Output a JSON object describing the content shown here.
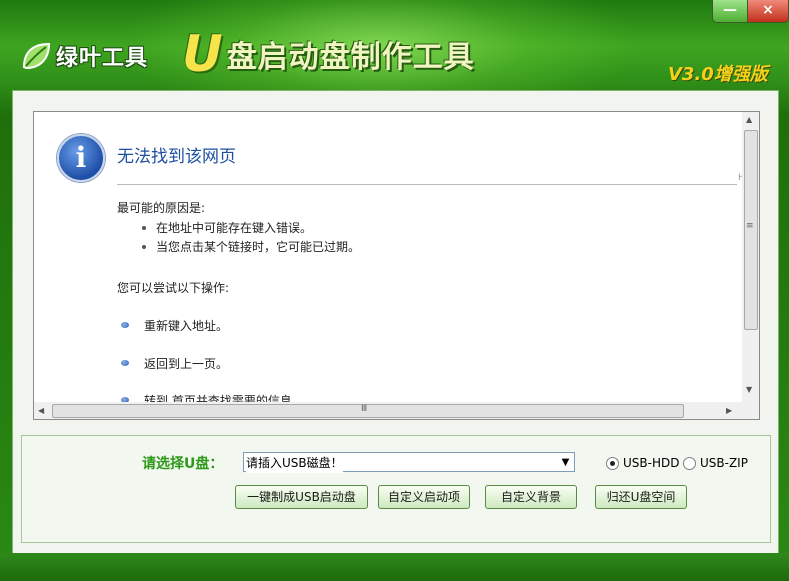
{
  "window": {
    "minimize_symbol": "—",
    "close_symbol": "×"
  },
  "header": {
    "brand": "绿叶工具",
    "title_u": "U",
    "title_rest": "盘启动盘制作工具",
    "version": "V3.0增强版"
  },
  "browser": {
    "title": "无法找到该网页",
    "scroll_marker": "H",
    "cause_heading": "最可能的原因是:",
    "causes": [
      "在地址中可能存在键入错误。",
      "当您点击某个链接时，它可能已过期。"
    ],
    "try_heading": "您可以尝试以下操作:",
    "actions": [
      "重新键入地址。",
      "返回到上一页。",
      "转到 首页并查找需要的信息。"
    ],
    "vscroll_grip": "≡",
    "hscroll_grip": "Ⅲ",
    "arrows": {
      "up": "▲",
      "down": "▼",
      "left": "◀",
      "right": "▶"
    }
  },
  "usb_panel": {
    "label": "请选择U盘：",
    "select_value": "请插入USB磁盘！",
    "select_arrow": "▼",
    "radios": [
      {
        "label": "USB-HDD",
        "selected": true
      },
      {
        "label": "USB-ZIP",
        "selected": false
      }
    ],
    "buttons": [
      "一键制成USB启动盘",
      "自定义启动项",
      "自定义背景",
      "归还U盘空间"
    ]
  },
  "colors": {
    "brand_green": "#2a8a14",
    "accent_yellow": "#f5d21a",
    "link_blue": "#1f4fa0"
  }
}
